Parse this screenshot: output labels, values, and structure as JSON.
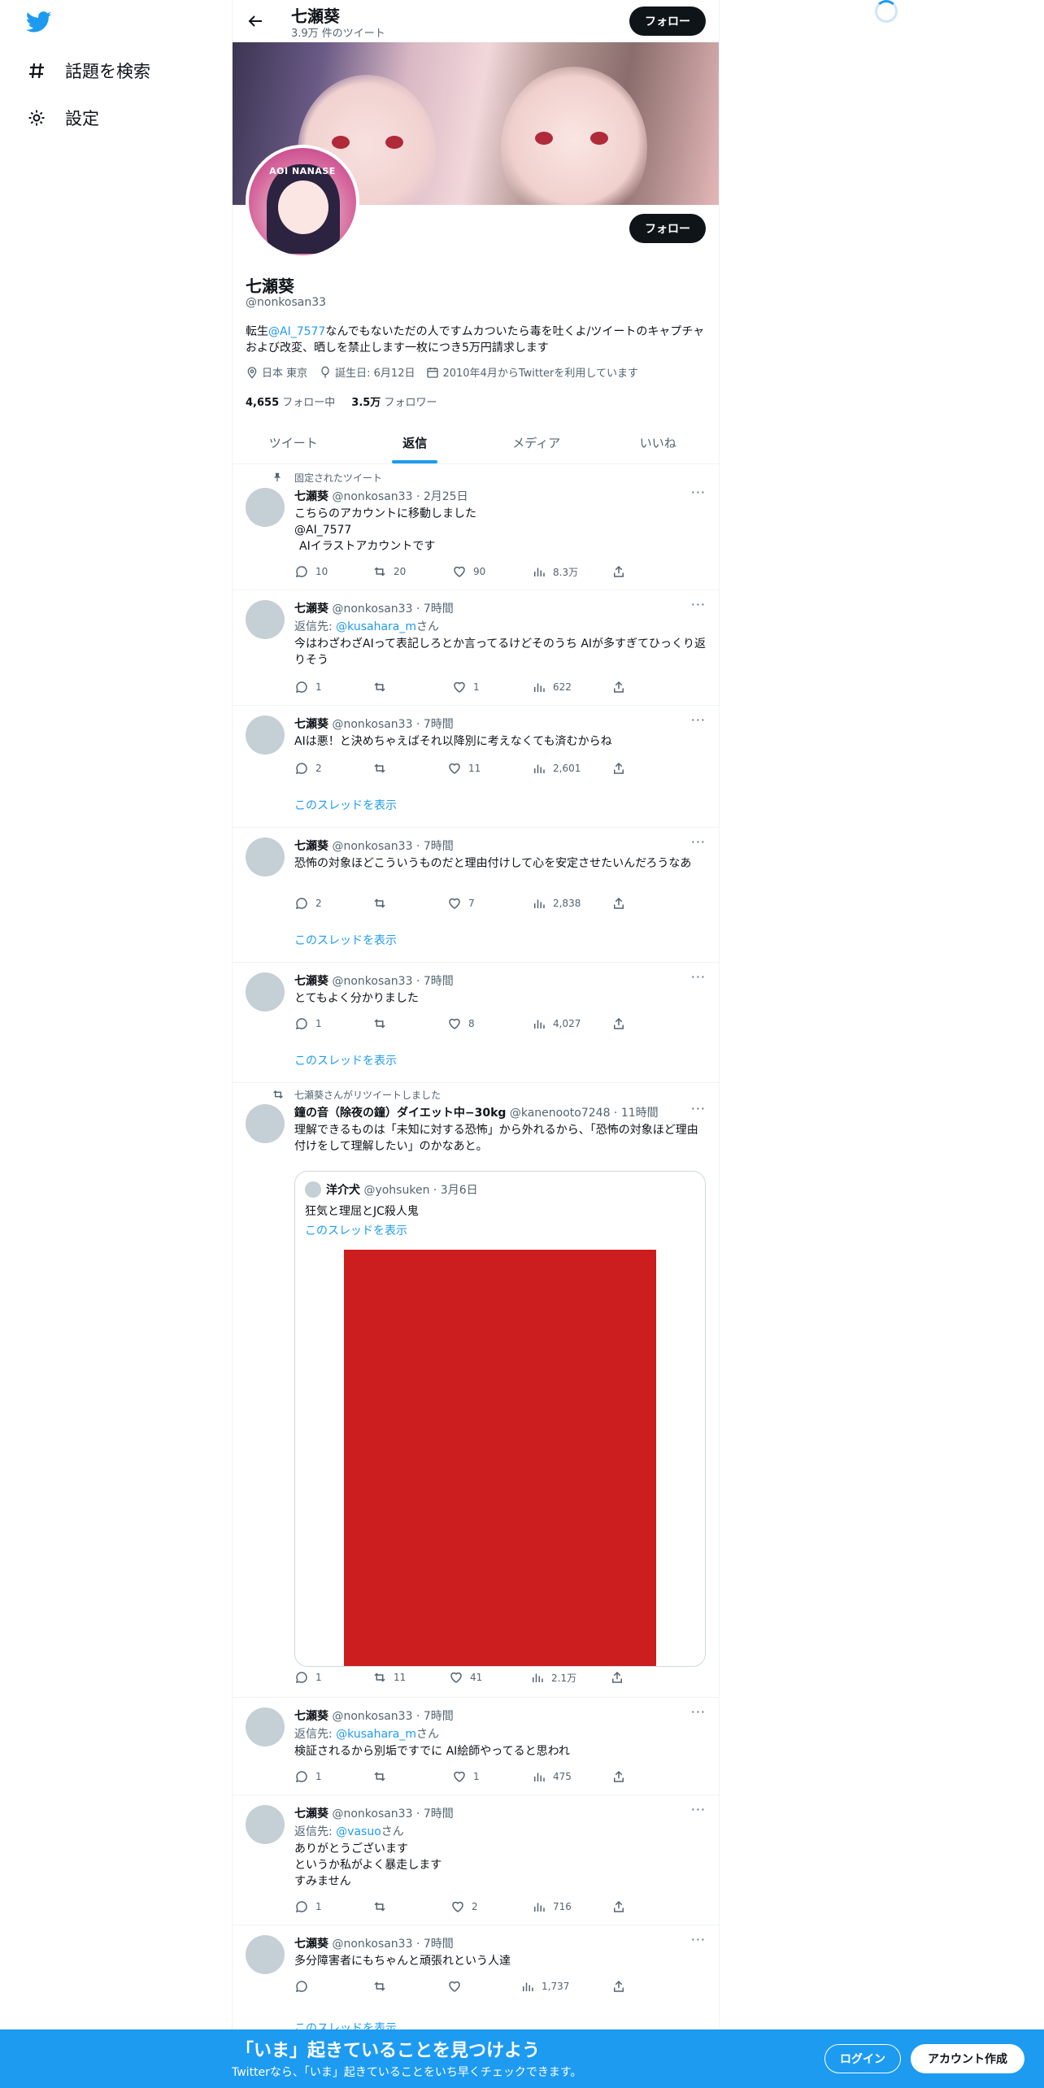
{
  "nav": {
    "explore_label": "話題を検索",
    "settings_label": "設定"
  },
  "header": {
    "name": "七瀬葵",
    "tweet_count": "3.9万 件のツイート",
    "follow_label": "フォロー"
  },
  "profile": {
    "avatar_text": "AOI NANASE",
    "name": "七瀬葵",
    "handle": "@nonkosan33",
    "follow_label": "フォロー",
    "bio_pre": "転生",
    "bio_link": "@AI_7577",
    "bio_post": "なんでもないただの人ですムカついたら毒を吐くよ/ツイートのキャプチャおよび改変、晒しを禁止します一枚につき5万円請求します",
    "location": "日本 東京",
    "birthday": "誕生日: 6月12日",
    "joined": "2010年4月からTwitterを利用しています",
    "following_count": "4,655",
    "following_label": "フォロー中",
    "followers_count": "3.5万",
    "followers_label": "フォロワー"
  },
  "tabs": [
    "ツイート",
    "返信",
    "メディア",
    "いいね"
  ],
  "tweets": [
    {
      "context": "固定されたツイート",
      "name": "七瀬葵",
      "meta": "@nonkosan33 · 2月25日",
      "line1": "こちらのアカウントに移動しました",
      "line2": "@AI_7577",
      "line3": "AIイラストアカウントです",
      "reply": "10",
      "retweet": "20",
      "like": "90",
      "views": "8.3万"
    },
    {
      "name": "七瀬葵",
      "meta": "@nonkosan33 · 7時間",
      "reply_to_pre": "返信先: ",
      "reply_to": "@kusahara_m",
      "reply_to_post": "さん",
      "text": "今はわざわざAIって表記しろとか言ってるけどそのうち AIが多すぎてひっくり返りそう",
      "reply": "1",
      "retweet": "",
      "like": "1",
      "views": "622"
    },
    {
      "name": "七瀬葵",
      "meta": "@nonkosan33 · 7時間",
      "text": "AIは悪！と決めちゃえばそれ以降別に考えなくても済むからね",
      "reply": "2",
      "retweet": "",
      "like": "11",
      "views": "2,601",
      "thread": "このスレッドを表示"
    },
    {
      "name": "七瀬葵",
      "meta": "@nonkosan33 · 7時間",
      "text": "恐怖の対象ほどこういうものだと理由付けして心を安定させたいんだろうなあ",
      "reply": "2",
      "retweet": "",
      "like": "7",
      "views": "2,838",
      "thread": "このスレッドを表示"
    },
    {
      "name": "七瀬葵",
      "meta": "@nonkosan33 · 7時間",
      "text": "とてもよく分かりました",
      "reply": "1",
      "retweet": "",
      "like": "8",
      "views": "4,027",
      "thread": "このスレッドを表示"
    },
    {
      "context": "七瀬葵さんがリツイートしました",
      "name": "鐘の音（除夜の鐘）ダイエット中−30kg",
      "meta": "@kanenooto7248 · 11時間",
      "text": "理解できるものは「未知に対する恐怖」から外れるから、「恐怖の対象ほど理由付けをして理解したい」のかなあと。",
      "quote": {
        "name": "洋介犬",
        "meta": "@yohsuken · 3月6日",
        "text": "狂気と理屈とJC殺人鬼",
        "thread": "このスレッドを表示"
      },
      "reply": "1",
      "retweet": "11",
      "like": "41",
      "views": "2.1万"
    },
    {
      "name": "七瀬葵",
      "meta": "@nonkosan33 · 7時間",
      "reply_to_pre": "返信先: ",
      "reply_to": "@kusahara_m",
      "reply_to_post": "さん",
      "text": "検証されるから別垢ですでに AI絵師やってると思われ",
      "reply": "1",
      "retweet": "",
      "like": "1",
      "views": "475"
    },
    {
      "name": "七瀬葵",
      "meta": "@nonkosan33 · 7時間",
      "reply_to_pre": "返信先: ",
      "reply_to": "@vasuo",
      "reply_to_post": "さん",
      "line1": "ありがとうございます",
      "line2": "というか私がよく暴走します",
      "line3": "すみません",
      "reply": "1",
      "retweet": "",
      "like": "2",
      "views": "716"
    },
    {
      "name": "七瀬葵",
      "meta": "@nonkosan33 · 7時間",
      "text": "多分障害者にもちゃんと頑張れという人達",
      "reply": "",
      "retweet": "",
      "like": "",
      "views": "1,737",
      "thread": "このスレッドを表示"
    }
  ],
  "bottom": {
    "title": "「いま」起きていることを見つけよう",
    "subtitle": "Twitterなら、「いま」起きていることをいち早くチェックできます。",
    "login_label": "ログイン",
    "signup_label": "アカウント作成"
  },
  "colors": {
    "accent": "#1d9bf0",
    "text": "#0f1419",
    "muted": "#536471",
    "quote_image": "#cc1d1f"
  }
}
